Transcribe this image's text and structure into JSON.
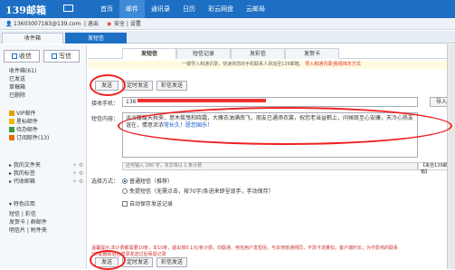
{
  "header": {
    "logo": "139邮箱",
    "nav": [
      "首页",
      "邮件",
      "通讯录",
      "日历",
      "彩云网盘",
      "云邮局"
    ]
  },
  "userbar": {
    "account": "13603007183@139.com",
    "logout": "| 退出",
    "safety": "安全 | 设置"
  },
  "top_tabs": [
    "收件箱",
    "发短信"
  ],
  "sidebar": {
    "receive_label": "收信",
    "write_label": "写信",
    "folders": [
      "收件箱(61)",
      "已发送",
      "草稿箱",
      "已删除"
    ],
    "special": [
      "VIP邮件",
      "星标邮件",
      "待办邮件",
      "订阅邮件(13)"
    ],
    "groups": [
      {
        "label": "我的文件夹"
      },
      {
        "label": "我的标签"
      },
      {
        "label": "代收邮箱"
      }
    ],
    "special_apps_label": "特色应用",
    "app_rows": [
      "短信 | 彩信",
      "发贺卡 | 群邮件",
      "明信片 | 附件夹"
    ]
  },
  "main": {
    "subtabs": [
      "发短信",
      "短信记录",
      "发彩信",
      "发贺卡"
    ],
    "notice": "一键导入和通讯录，快速将您的手机联系人添加至139邮箱。",
    "notice_link": "导入和通讯录|我很抹灰方式",
    "send_label": "发送",
    "timed_send_label": "定时发送",
    "card_send_label": "彩信发送",
    "receiver_label": "接收手机：",
    "receiver_prefix": "136",
    "import_label": "导入",
    "content_label": "短信内容：",
    "message": "淡淡暖暖天秋来，意木摇曳和晓霜，大雁衣油满南飞，朋友已通添衣裳，祝您老当益鹤上，问候既至心安康，天冷心热友谊在，情意浓浓",
    "message_hl": "常长久！愿您国乐！",
    "counter": "还可输入 280 字，本次将以 1 条计费",
    "signature": "【来自139邮箱】",
    "choose_label": "选择方式：",
    "option1": "普通短信（推荐）",
    "option2": "免提短信（无需点击，按70字/条进来即呈现手，手动保存）",
    "autosave": "自动保存发送记录",
    "footnote": "温馨提示:本计费都需要10条，本10条，超出按0.1元/条计费。向联通、电信用户发短信，与本地普通网同，不改卡流量扣。客户端时长，为不影响的联系",
    "footnote2": "*只能删除后台登录发送过后保留记录"
  },
  "colors": {
    "brand": "#1d6fc4",
    "highlight": "#e22"
  }
}
